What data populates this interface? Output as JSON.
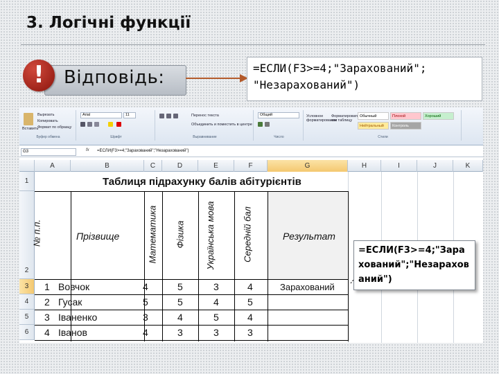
{
  "slide": {
    "title": "3. Логічні функції",
    "answer_label": "Відповідь:",
    "excl_mark": "!",
    "formula_line1": "=ЕСЛИ(F3>=4;\"Зарахований\";",
    "formula_line2": "\"Незарахований\")"
  },
  "excel": {
    "namebox": "G3",
    "fx_label": "fx",
    "formula_bar": "=ЕСЛИ(F3>=4;\"Зарахований\";\"Незарахований\")",
    "ribbon": {
      "paste": "Вставить",
      "cut": "Вырезать",
      "copy": "Копировать",
      "format_painter": "Формат по образцу",
      "font_name": "Arial",
      "font_size": "11",
      "wrap_text": "Перенос текста",
      "merge": "Объединить и поместить в центре",
      "number_format": "Общий",
      "cond_format": "Условное форматирование",
      "format_table": "Форматировать как таблицу",
      "group_clipboard": "Буфер обмена",
      "group_font": "Шрифт",
      "group_alignment": "Выравнивание",
      "group_number": "Число",
      "group_styles": "Стили",
      "styles": [
        "Обычный",
        "Плохой",
        "Хороший",
        "Нейтральный",
        "Контроль"
      ]
    },
    "columns": [
      "A",
      "B",
      "C",
      "D",
      "E",
      "F",
      "G",
      "H",
      "I",
      "J",
      "K"
    ],
    "rows": [
      "1",
      "2",
      "3",
      "4",
      "5",
      "6"
    ],
    "table_title": "Таблиця підрахунку балів абітурієнтів",
    "headers": {
      "num": "№ п.п.",
      "surname": "Прізвище",
      "math": "Математика",
      "physics": "Фізика",
      "ukr": "Українська мова",
      "avg": "Середній бал",
      "result": "Результат"
    },
    "data_rows": [
      {
        "n": "1",
        "name": "Вовчок",
        "math": "4",
        "phys": "5",
        "ukr": "3",
        "avg": "4",
        "result": "Зарахований"
      },
      {
        "n": "2",
        "name": "Гусак",
        "math": "5",
        "phys": "5",
        "ukr": "4",
        "avg": "5",
        "result": ""
      },
      {
        "n": "3",
        "name": "Іваненко",
        "math": "3",
        "phys": "4",
        "ukr": "5",
        "avg": "4",
        "result": ""
      },
      {
        "n": "4",
        "name": "Іванов",
        "math": "4",
        "phys": "3",
        "ukr": "3",
        "avg": "3",
        "result": ""
      }
    ],
    "callout": "=ЕСЛИ(F3>=4;\"Зара\nхований\";\"Незарахов\nаний\")"
  },
  "colors": {
    "selected_header": "#f4c870",
    "style_bad": "#ffc7ce",
    "style_good": "#c6efce",
    "style_neutral": "#ffeb9c",
    "excl_red": "#b3261a"
  }
}
